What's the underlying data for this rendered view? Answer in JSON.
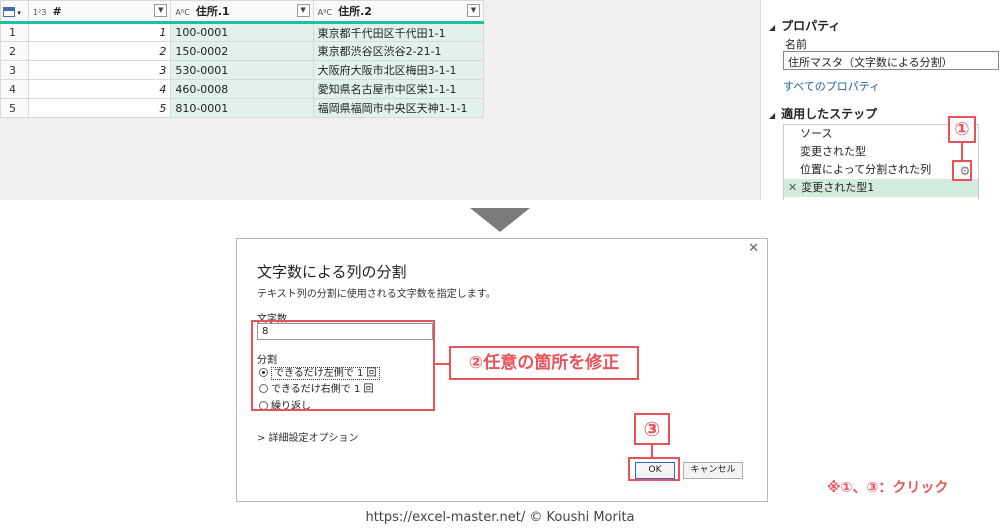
{
  "table": {
    "headers": [
      {
        "type": "1²3",
        "label": "#"
      },
      {
        "type": "AᴮC",
        "label": "住所.1"
      },
      {
        "type": "AᴮC",
        "label": "住所.2"
      }
    ],
    "rows": [
      {
        "n": "1",
        "num": "1",
        "c1": "100-0001",
        "c2": "東京都千代田区千代田1-1"
      },
      {
        "n": "2",
        "num": "2",
        "c1": "150-0002",
        "c2": "東京都渋谷区渋谷2-21-1"
      },
      {
        "n": "3",
        "num": "3",
        "c1": "530-0001",
        "c2": "大阪府大阪市北区梅田3-1-1"
      },
      {
        "n": "4",
        "num": "4",
        "c1": "460-0008",
        "c2": "愛知県名古屋市中区栄1-1-1"
      },
      {
        "n": "5",
        "num": "5",
        "c1": "810-0001",
        "c2": "福岡県福岡市中央区天神1-1-1"
      }
    ]
  },
  "panel": {
    "properties_title": "プロパティ",
    "name_label": "名前",
    "name_value": "住所マスタ（文字数による分割）",
    "all_properties": "すべてのプロパティ",
    "steps_title": "適用したステップ",
    "steps": [
      "ソース",
      "変更された型",
      "位置によって分割された列",
      "変更された型1"
    ]
  },
  "markers": {
    "one": "①",
    "two": "②任意の箇所を修正",
    "three": "③"
  },
  "dialog": {
    "close": "✕",
    "title": "文字数による列の分割",
    "description": "テキスト列の分割に使用される文字数を指定します。",
    "length_label": "文字数",
    "length_value": "8",
    "split_label": "分割",
    "options": [
      "できるだけ左側で 1 回",
      "できるだけ右側で 1 回",
      "繰り返し"
    ],
    "advanced": "> 詳細設定オプション",
    "ok": "OK",
    "cancel": "キャンセル"
  },
  "note": "※①、③：クリック",
  "credit": "https://excel-master.net/  © Koushi Morita",
  "colors": {
    "accent_red": "#e8535a",
    "column_green": "#e2f2ea",
    "header_teal": "#1fbf9f"
  }
}
